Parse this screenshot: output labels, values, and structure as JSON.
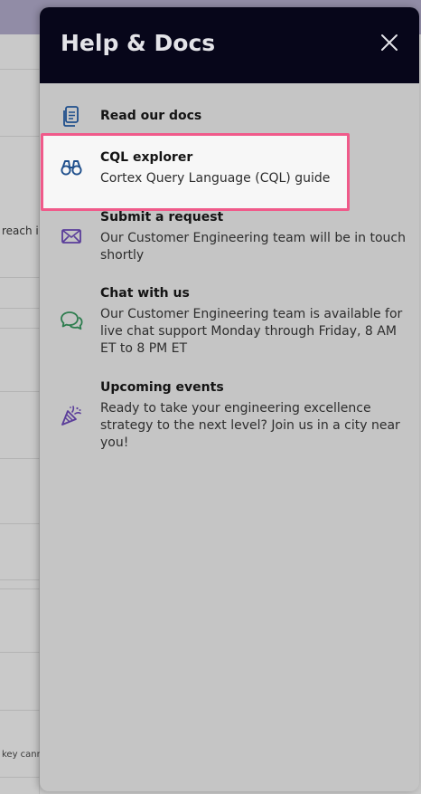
{
  "background": {
    "fragment_reach": "reach i",
    "fragment_key": "key cann"
  },
  "drawer": {
    "title": "Help & Docs",
    "close_icon": "close-icon",
    "items": [
      {
        "title": "Read our docs",
        "description": "",
        "icon": "document-icon"
      },
      {
        "title": "CQL explorer",
        "description": "Cortex Query Language (CQL) guide",
        "icon": "binoculars-icon",
        "highlighted": true
      },
      {
        "title": "Submit a request",
        "description": "Our Customer Engineering team will be in touch shortly",
        "icon": "envelope-icon"
      },
      {
        "title": "Chat with us",
        "description": "Our Customer Engineering team is available for live chat support Monday through Friday, 8 AM ET to 8 PM ET",
        "icon": "chat-bubbles-icon"
      },
      {
        "title": "Upcoming events",
        "description": "Ready to take your engineering excellence strategy to the next level? Join us in a city near you!",
        "icon": "party-popper-icon"
      }
    ]
  },
  "colors": {
    "header_bg": "#07061a",
    "highlight_border": "#f05a8a",
    "icon_blue": "#1f4f8c",
    "icon_green": "#2e7d4f",
    "icon_purple": "#5a3d9a"
  }
}
